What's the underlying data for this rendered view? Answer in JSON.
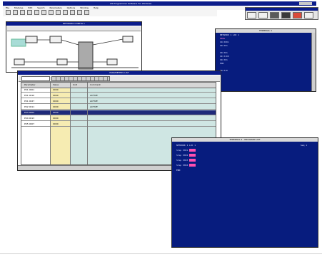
{
  "app": {
    "title": "LIS Programmer Software For Windows",
    "menu": [
      "File",
      "Modules",
      "Edit",
      "Search",
      "Parameters",
      "Options",
      "Window",
      "Help"
    ]
  },
  "small_tools": [
    "tool-1",
    "tool-2",
    "tool-3",
    "tool-4",
    "tool-5",
    "tool-6"
  ],
  "diagram_window": {
    "title": "NETWORK CONFIG 1"
  },
  "spreadsheet": {
    "title": "PARAMETERS LIST",
    "headers": [
      "Parameter",
      "Value",
      "Unit",
      "Comment"
    ],
    "rows": [
      {
        "param": "P01 0001",
        "val": "0000",
        "unit": "",
        "comment": ""
      },
      {
        "param": "P01 0010",
        "val": "0000",
        "unit": "",
        "comment": "ACTIVE"
      },
      {
        "param": "P01 0027",
        "val": "0000",
        "unit": "",
        "comment": "ACTIVE"
      },
      {
        "param": "P02 0011",
        "val": "0000",
        "unit": "",
        "comment": "ACTIVE"
      },
      {
        "param": "P03 0002",
        "val": "0000",
        "unit": "",
        "comment": ""
      },
      {
        "param": "P04 0013",
        "val": "0000",
        "unit": "",
        "comment": ""
      },
      {
        "param": "P05 0007",
        "val": "0000",
        "unit": "",
        "comment": ""
      }
    ],
    "selected_row": 4
  },
  "terminal_small": {
    "title": "TERMINAL 1",
    "lines": [
      "NETWORK 1 LOC 1",
      "PROG",
      "    IN  0001",
      "    ON  001",
      "",
      "    ON  001",
      "    OR  0100",
      "    ON  001",
      "END",
      "",
      "    ON  010"
    ]
  },
  "terminal_large": {
    "title": "TERMINAL 2 - PROGRAM LIST",
    "header_left": "NETWORK 1 LOC 1",
    "header_right": "Seq 1",
    "lines": [
      "Step  0001",
      "Step  0002",
      "Step  0003",
      "Step  0004",
      "END"
    ]
  }
}
